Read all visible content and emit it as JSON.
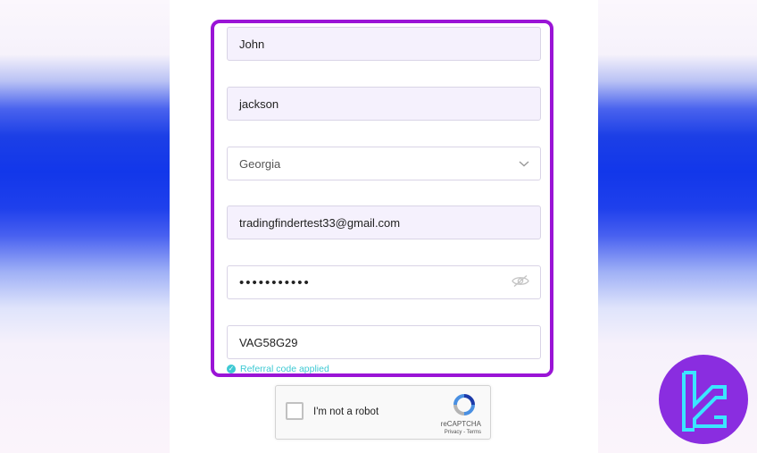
{
  "form": {
    "first_name": "John",
    "last_name": "jackson",
    "country": "Georgia",
    "email": "tradingfindertest33@gmail.com",
    "password_masked": "•••••••••••",
    "referral_code": "VAG58G29",
    "referral_status": "Referral code applied"
  },
  "captcha": {
    "label": "I'm not a robot",
    "brand": "reCAPTCHA",
    "links": "Privacy - Terms"
  },
  "colors": {
    "highlight": "#9a14d6",
    "accent_teal": "#3ec9d3",
    "field_bg": "#f5f1fd",
    "logo_bg": "#8a2de0"
  },
  "icons": {
    "country_dropdown": "chevron-down-icon",
    "password_toggle": "eye-off-icon",
    "referral_check": "check-circle-icon",
    "captcha_logo": "recaptcha-logo-icon",
    "brand_logo": "tradingfinder-logo-icon"
  }
}
